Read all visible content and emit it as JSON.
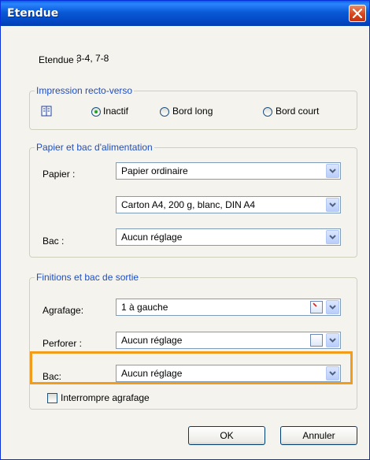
{
  "window": {
    "title": "Etendue"
  },
  "range": {
    "label": "Etendue :",
    "value": "3-4, 7-8"
  },
  "duplex": {
    "legend": "Impression recto-verso",
    "icon": "duplex-page-icon",
    "options": [
      {
        "label": "Inactif",
        "checked": true
      },
      {
        "label": "Bord long",
        "checked": false
      },
      {
        "label": "Bord court",
        "checked": false
      }
    ]
  },
  "paper": {
    "legend": "Papier et bac d'alimentation",
    "paper_label": "Papier :",
    "paper_value": "Papier ordinaire",
    "paper_type_value": "Carton A4, 200 g, blanc, DIN A4",
    "tray_label": "Bac :",
    "tray_value": "Aucun réglage"
  },
  "finishing": {
    "legend": "Finitions et bac de sortie",
    "stapling_label": "Agrafage:",
    "stapling_value": "1 à gauche",
    "punch_label": "Perforer :",
    "punch_value": "Aucun réglage",
    "output_tray_label": "Bac:",
    "output_tray_value": "Aucun réglage",
    "interrupt_label": "Interrompre agrafage",
    "interrupt_checked": false
  },
  "buttons": {
    "ok": "OK",
    "cancel": "Annuler"
  },
  "colors": {
    "titlebar": "#0a5ad6",
    "group_label": "#1e4ec2",
    "highlight": "#f39b1b",
    "close_button": "#d9451d"
  }
}
